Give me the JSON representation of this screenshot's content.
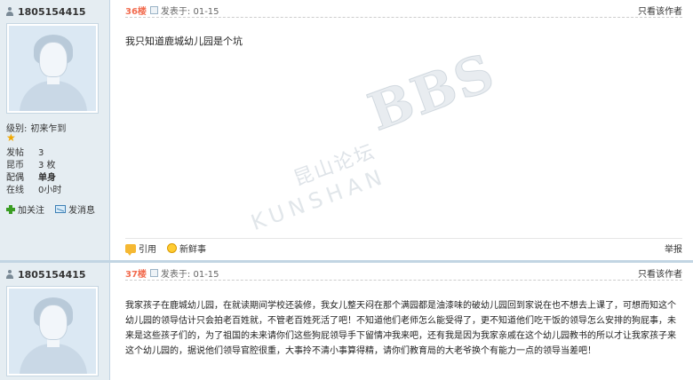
{
  "posts": [
    {
      "username": "1805154415",
      "level_label": "级别:",
      "level_value": "初来乍到",
      "stats": [
        {
          "key": "发帖",
          "value": "3"
        },
        {
          "key": "昆币",
          "value": "3 枚"
        },
        {
          "key": "配偶",
          "value": "单身"
        },
        {
          "key": "在线",
          "value": "0小时"
        }
      ],
      "follow_label": "加关注",
      "message_label": "发消息",
      "floor": "36楼",
      "date": "发表于: 01-15",
      "only_author": "只看该作者",
      "content": "我只知道鹿城幼儿园是个坑",
      "quote_label": "引用",
      "fresh_label": "新鲜事",
      "report_label": "举报"
    },
    {
      "username": "1805154415",
      "floor": "37楼",
      "date": "发表于: 01-15",
      "only_author": "只看该作者",
      "content": "我家孩子在鹿城幼儿园，在就读期间学校还装修，我女儿整天闷在那个满园都是油漆味的破幼儿园回到家说在也不想去上课了，可想而知这个幼儿园的领导估计只会拍老百姓就，不管老百姓死活了吧！不知道他们老师怎么能受得了，更不知道他们吃干饭的领导怎么安排的狗屁事，未来是这些孩子们的，为了祖国的未来请你们这些狗屁领导手下留情冲我来吧，还有我是因为我家亲戚在这个幼儿园教书的所以才让我家孩子来这个幼儿园的，据说他们领导官腔很重，大事拎不清小事算得精，请你们教育局的大老爷换个有能力一点的领导当差吧！"
    }
  ],
  "watermark": {
    "cn": "昆山论坛",
    "en": "KUNSHAN",
    "bbs": "BBS"
  },
  "colors": {
    "sidebar_bg": "#e5edf2",
    "border": "#c2d5e3",
    "floor": "#f26c4f"
  }
}
